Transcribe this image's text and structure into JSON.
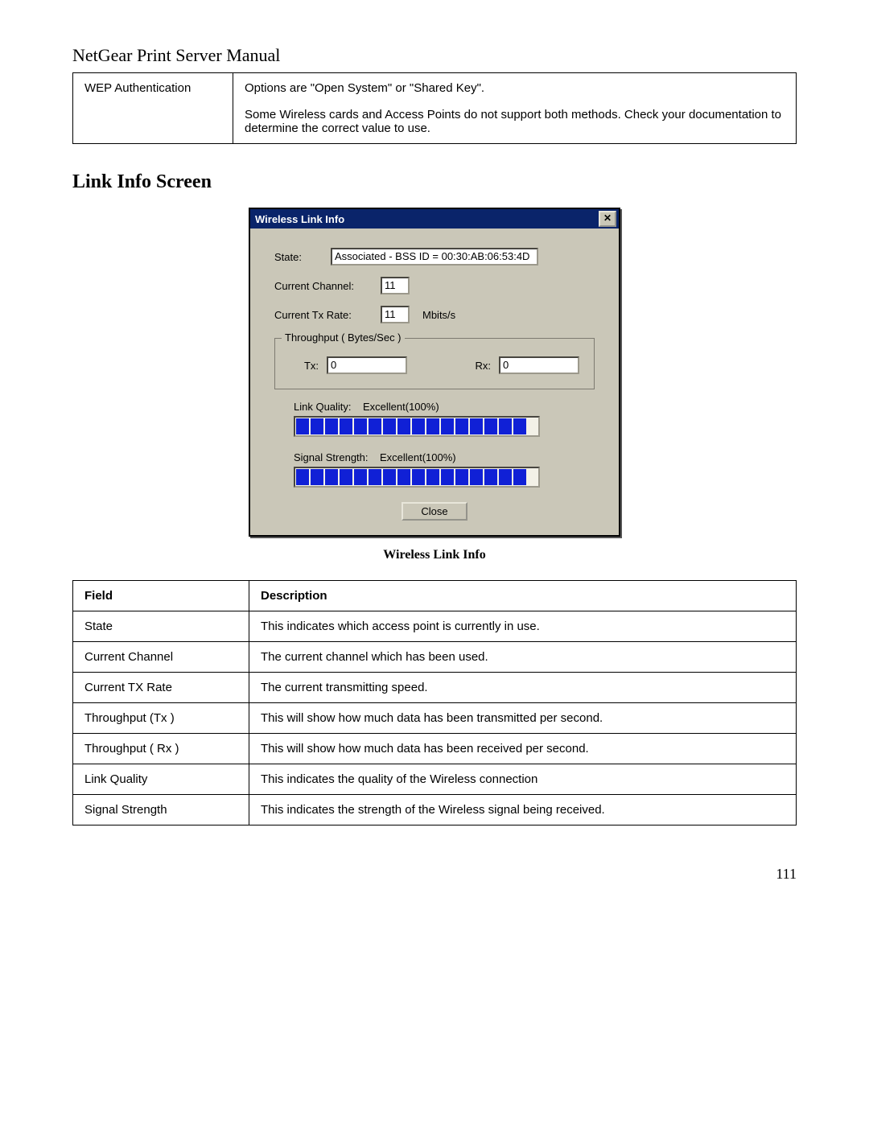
{
  "doc_title": "NetGear Print Server Manual",
  "wep_table": {
    "label": "WEP Authentication",
    "desc_p1": "Options are \"Open System\" or \"Shared Key\".",
    "desc_p2": "Some Wireless cards and Access Points do not support both methods. Check your documentation to determine the correct value to use."
  },
  "section_heading": "Link Info Screen",
  "dialog": {
    "title": "Wireless Link Info",
    "close_glyph": "✕",
    "labels": {
      "state": "State:",
      "channel": "Current Channel:",
      "txrate": "Current Tx Rate:",
      "txrate_units": "Mbits/s",
      "group_legend": "Throughput ( Bytes/Sec )",
      "tx": "Tx:",
      "rx": "Rx:",
      "link_quality": "Link Quality:",
      "signal_strength": "Signal Strength:"
    },
    "values": {
      "state_value": "Associated - BSS ID = 00:30:AB:06:53:4D",
      "channel": "11",
      "txrate": "11",
      "tx": "0",
      "rx": "0",
      "link_quality_text": "Excellent(100%)",
      "signal_strength_text": "Excellent(100%)"
    },
    "close_button": "Close"
  },
  "figure_caption": "Wireless Link Info",
  "desc_table": {
    "headers": {
      "field": "Field",
      "description": "Description"
    },
    "rows": [
      {
        "field": "State",
        "desc": "This indicates which access point is currently in use."
      },
      {
        "field": "Current Channel",
        "desc": "The current channel which has been used."
      },
      {
        "field": "Current TX Rate",
        "desc": "The current transmitting speed."
      },
      {
        "field": "Throughput (Tx )",
        "desc": "This will show how much data has been transmitted per second."
      },
      {
        "field": "Throughput ( Rx )",
        "desc": "This will show how much data has been received per second."
      },
      {
        "field": "Link Quality",
        "desc": "This indicates the quality of the Wireless connection"
      },
      {
        "field": "Signal Strength",
        "desc": "This indicates the strength of the Wireless signal being received."
      }
    ]
  },
  "page_number": "111"
}
